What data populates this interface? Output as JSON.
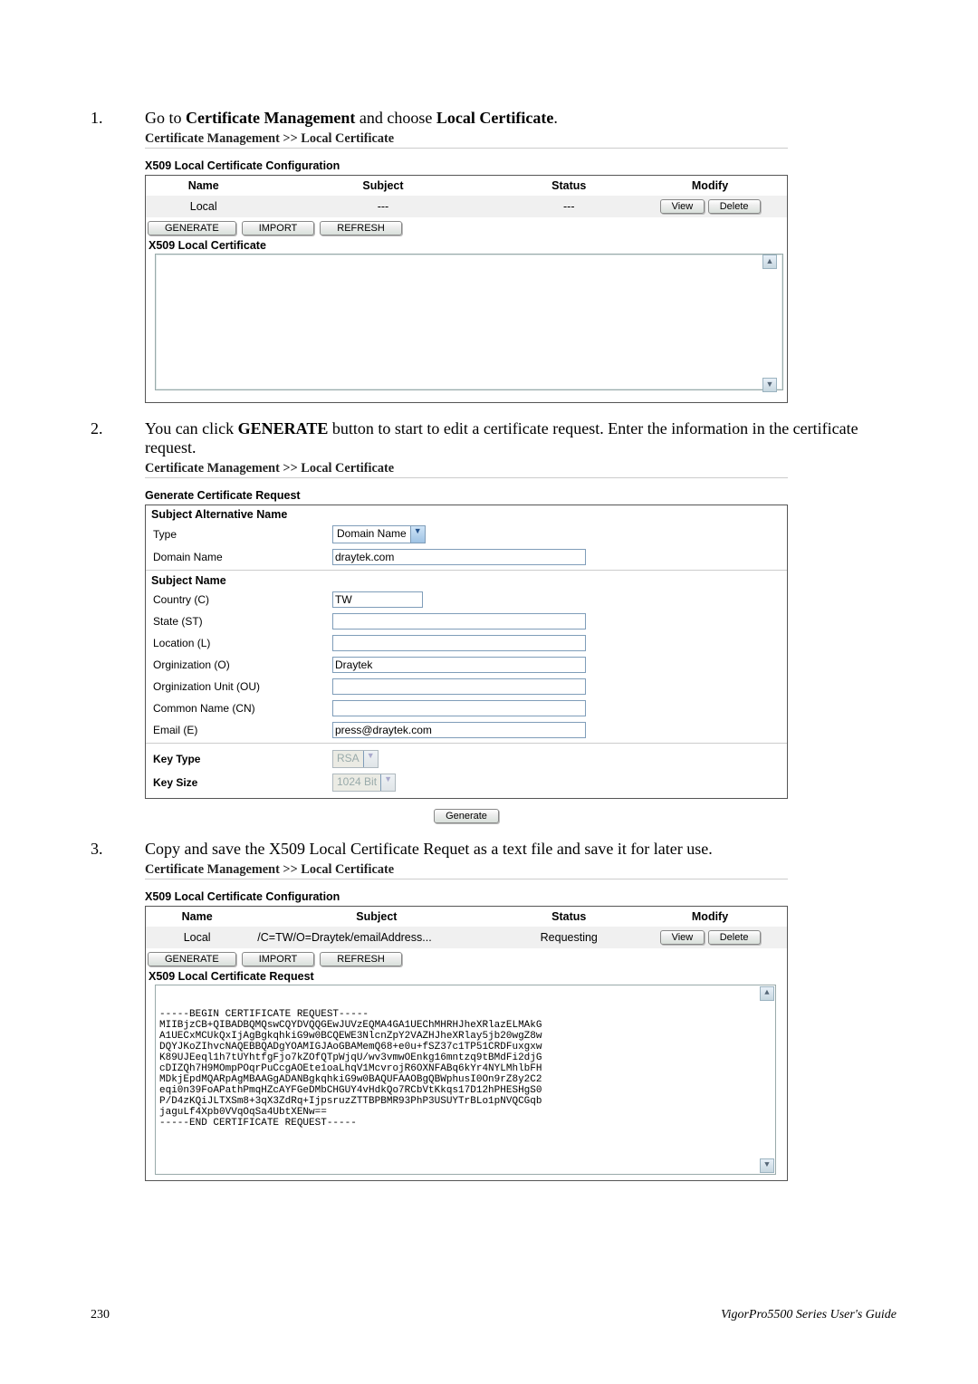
{
  "steps": {
    "s1_num": "1.",
    "s1_text_a": "Go to ",
    "s1_text_b": "Certificate Management",
    "s1_text_c": " and choose ",
    "s1_text_d": "Local Certificate",
    "s1_text_e": ".",
    "s2_num": "2.",
    "s2_text_a": "You can click ",
    "s2_text_b": "GENERATE",
    "s2_text_c": " button to start to edit a certificate request. Enter the information in the certificate request.",
    "s3_num": "3.",
    "s3_text": "Copy and save the X509 Local Certificate Requet as a text file and save it for later use."
  },
  "breadcrumb": "Certificate Management >> Local Certificate",
  "table": {
    "title": "X509 Local Certificate Configuration",
    "hdr_name": "Name",
    "hdr_subject": "Subject",
    "hdr_status": "Status",
    "hdr_modify": "Modify",
    "row1_name": "Local",
    "row1_subject": "---",
    "row1_status": "---",
    "btn_view": "View",
    "btn_delete": "Delete",
    "btn_generate": "GENERATE",
    "btn_import": "IMPORT",
    "btn_refresh": "REFRESH",
    "sub_title": "X509 Local Certificate"
  },
  "genform": {
    "title": "Generate Certificate Request",
    "san_title": "Subject Alternative Name",
    "type_lbl": "Type",
    "type_val": "Domain Name",
    "dn_lbl": "Domain Name",
    "dn_val": "draytek.com",
    "sn_title": "Subject Name",
    "c_lbl": "Country (C)",
    "c_val": "TW",
    "st_lbl": "State (ST)",
    "st_val": "",
    "l_lbl": "Location (L)",
    "l_val": "",
    "o_lbl": "Orginization (O)",
    "o_val": "Draytek",
    "ou_lbl": "Orginization Unit (OU)",
    "ou_val": "",
    "cn_lbl": "Common Name (CN)",
    "cn_val": "",
    "e_lbl": "Email (E)",
    "e_val": "press@draytek.com",
    "kt_lbl": "Key Type",
    "kt_val": "RSA",
    "ks_lbl": "Key Size",
    "ks_val": "1024 Bit",
    "gen_btn": "Generate"
  },
  "table3": {
    "row1_subject": "/C=TW/O=Draytek/emailAddress...",
    "row1_status": "Requesting",
    "sub_title": "X509 Local Certificate Request"
  },
  "certtext": "-----BEGIN CERTIFICATE REQUEST-----\nMIIBjzCB+QIBADBQMQswCQYDVQQGEwJUVzEQMA4GA1UEChMHRHJheXRlazELMAkG\nA1UECxMCUkQxIjAgBgkqhkiG9w0BCQEWE3NlcnZpY2VAZHJheXRlay5jb20wgZ8w\nDQYJKoZIhvcNAQEBBQADgYOAMIGJAoGBAMemQ68+e0u+fSZ37c1TP51CRDFuxgxw\nK89UJEeql1h7tUYhtfgFjo7kZOfQTpWjqU/wv3vmwOEnkg16mntzq9tBMdFi2djG\ncDIZQh7H9MOmpPOqrPuCcgAOEte1oaLhqV1McvrojR6OXNFABq6kYr4NYLMhlbFH\nMDkjEpdMQARpAgMBAAGgADANBgkqhkiG9w0BAQUFAAOBgQBWphusI0On9rZ8y2C2\neqi0n39FoAPathPmqHZcAYFGeDMbCHGUY4vHdkQo7RCbVtKkqs17D12hPHESHgS0\nP/D4zKQiJLTXSm8+3qX3ZdRq+IjpsruzZTTBPBMR93PhP3USUYTrBLo1pNVQCGqb\njaguLf4Xpb0VVqOqSa4UbtXENw==\n-----END CERTIFICATE REQUEST-----",
  "footer": {
    "page": "230",
    "guide_a": "VigorPro5500 Series User's Guide"
  }
}
